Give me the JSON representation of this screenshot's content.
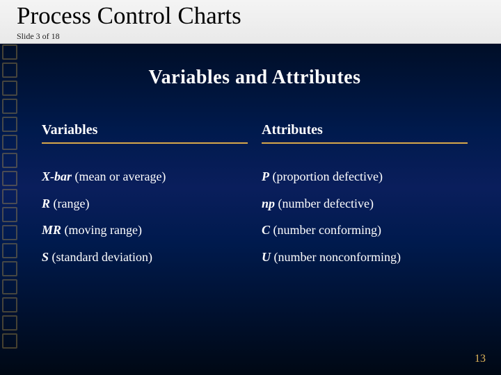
{
  "header": {
    "title": "Process Control Charts",
    "slide_counter": "Slide 3 of 18"
  },
  "section_title": "Variables and Attributes",
  "columns": {
    "left": {
      "heading": "Variables",
      "items": [
        {
          "symbol": "X-bar",
          "symbol_italic": true,
          "desc": " (mean or average)"
        },
        {
          "symbol": "R",
          "symbol_italic": true,
          "desc": " (range)"
        },
        {
          "symbol": "MR",
          "symbol_italic": true,
          "desc": " (moving range)"
        },
        {
          "symbol": "S",
          "symbol_italic": true,
          "desc": " (standard deviation)"
        }
      ]
    },
    "right": {
      "heading": "Attributes",
      "items": [
        {
          "symbol": "P",
          "symbol_italic": true,
          "desc": " (proportion defective)"
        },
        {
          "symbol": "np",
          "symbol_italic": true,
          "desc": " (number defective)"
        },
        {
          "symbol": "C",
          "symbol_italic": true,
          "desc": " (number conforming)"
        },
        {
          "symbol": "U",
          "symbol_italic": true,
          "desc": " (number nonconforming)"
        }
      ]
    }
  },
  "page_number": "13",
  "accent_color": "#d8a84a"
}
